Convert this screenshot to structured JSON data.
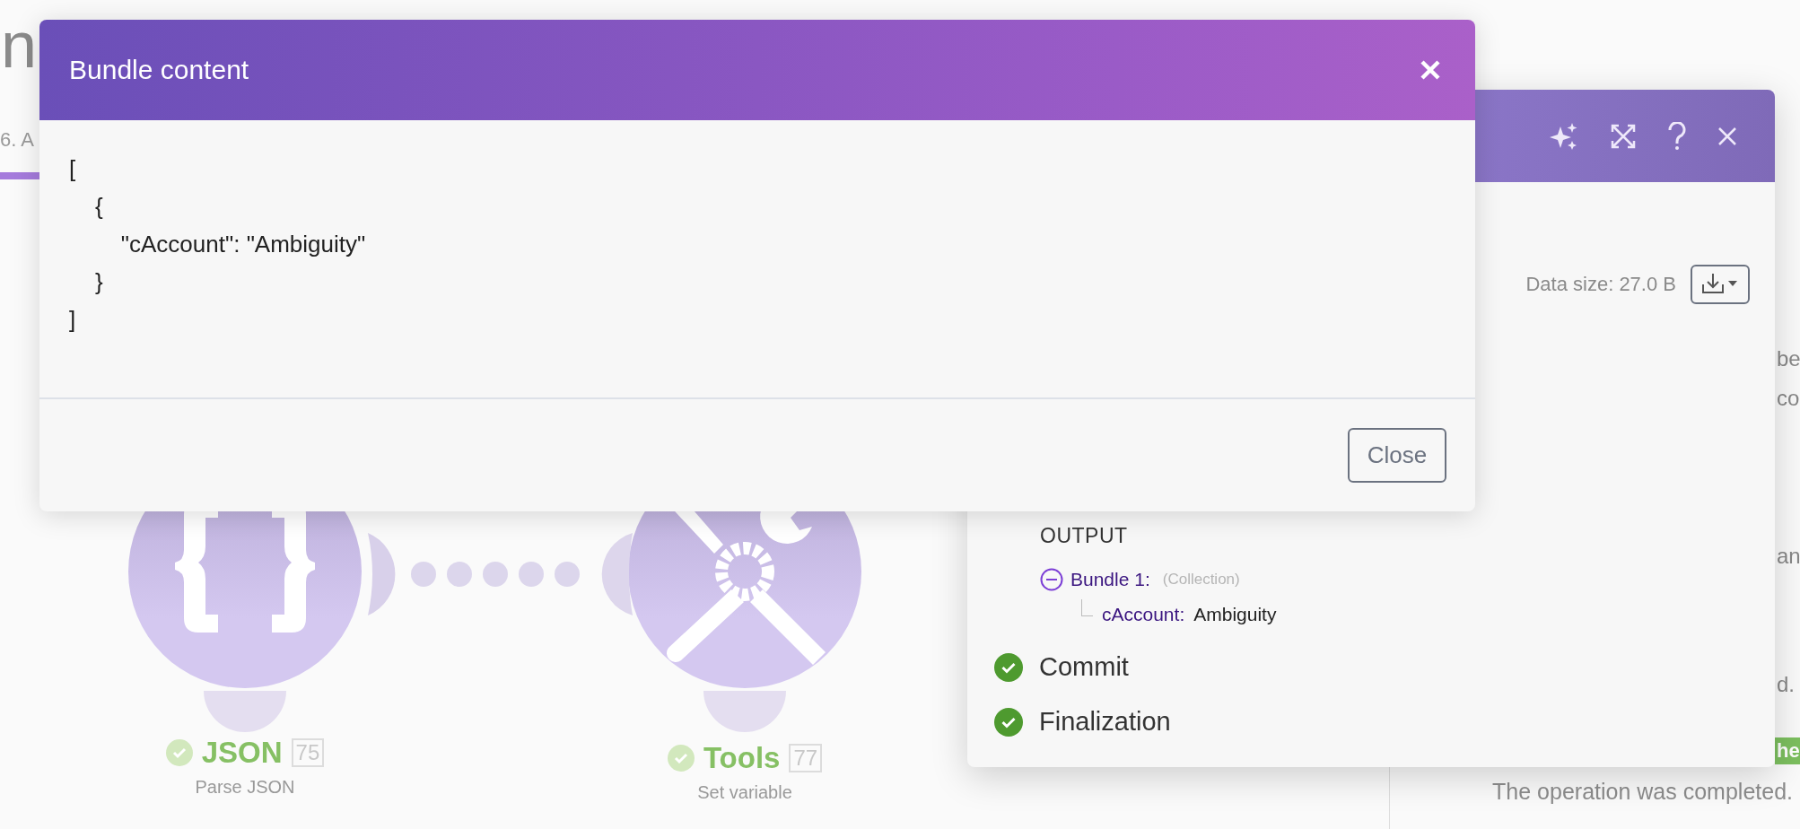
{
  "page": {
    "heading": "n",
    "tab": "6. A"
  },
  "scenario": {
    "modules": [
      {
        "kind": "json",
        "name": "JSON",
        "number": "75",
        "subtitle": "Parse JSON",
        "completed": true
      },
      {
        "kind": "tools",
        "name": "Tools",
        "number": "77",
        "subtitle": "Set variable",
        "completed": true
      }
    ]
  },
  "inspector": {
    "data_size": "Data size: 27.0 B",
    "output": {
      "heading": "OUTPUT",
      "bundles": [
        {
          "label": "Bundle 1:",
          "type": "(Collection)",
          "expanded": true,
          "children": [
            {
              "key": "cAccount:",
              "value": "Ambiguity"
            }
          ]
        }
      ]
    },
    "phases": [
      {
        "label": "Commit",
        "completed": true
      },
      {
        "label": "Finalization",
        "completed": true
      }
    ]
  },
  "side_panel": {
    "fragments": [
      "be",
      "co",
      "an",
      "d."
    ],
    "badge": "he",
    "message": "The operation was completed."
  },
  "modal": {
    "title": "Bundle content",
    "code": "[\n    {\n        \"cAccount\": \"Ambiguity\"\n    }\n]",
    "close_button": "Close"
  }
}
